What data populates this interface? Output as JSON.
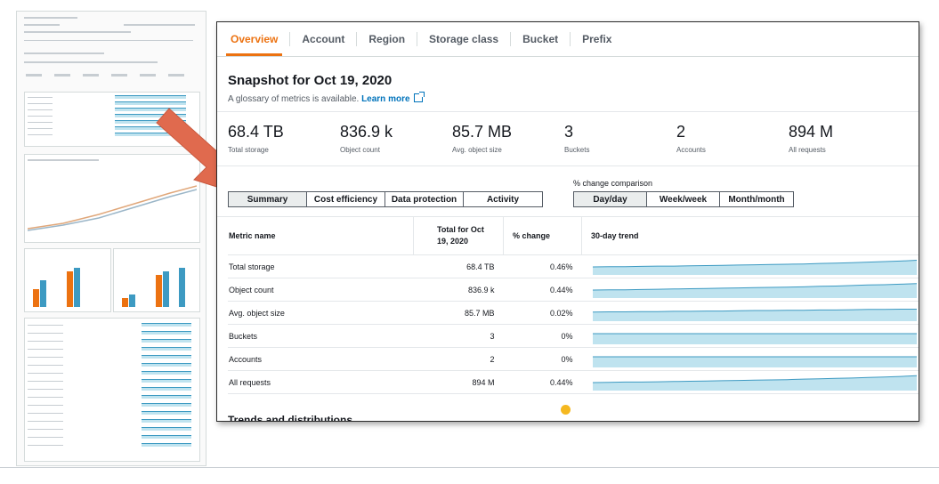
{
  "tabs": [
    {
      "label": "Overview",
      "active": true
    },
    {
      "label": "Account",
      "active": false
    },
    {
      "label": "Region",
      "active": false
    },
    {
      "label": "Storage class",
      "active": false
    },
    {
      "label": "Bucket",
      "active": false
    },
    {
      "label": "Prefix",
      "active": false
    }
  ],
  "snapshot": {
    "title": "Snapshot for Oct 19, 2020",
    "glossary_text": "A glossary of metrics is available.",
    "learn_more": "Learn more"
  },
  "metrics": [
    {
      "value": "68.4 TB",
      "label": "Total storage"
    },
    {
      "value": "836.9 k",
      "label": "Object count"
    },
    {
      "value": "85.7 MB",
      "label": "Avg. object size"
    },
    {
      "value": "3",
      "label": "Buckets"
    },
    {
      "value": "2",
      "label": "Accounts"
    },
    {
      "value": "894 M",
      "label": "All requests"
    }
  ],
  "view_tabs": [
    "Summary",
    "Cost efficiency",
    "Data protection",
    "Activity"
  ],
  "view_selected": "Summary",
  "comparison": {
    "label": "% change comparison",
    "options": [
      "Day/day",
      "Week/week",
      "Month/month"
    ],
    "selected": "Day/day"
  },
  "table": {
    "headers": {
      "metric": "Metric name",
      "total": "Total for Oct 19, 2020",
      "change": "% change",
      "trend": "30-day trend"
    },
    "rows": [
      {
        "name": "Total storage",
        "total": "68.4 TB",
        "change": "0.46%",
        "trend": [
          30,
          31,
          31,
          32,
          33,
          33,
          34,
          35,
          36,
          37,
          38,
          39,
          40,
          41,
          43,
          44,
          46,
          48,
          50,
          52,
          55
        ]
      },
      {
        "name": "Object count",
        "total": "836.9 k",
        "change": "0.44%",
        "trend": [
          30,
          31,
          31,
          32,
          33,
          34,
          35,
          36,
          37,
          38,
          39,
          40,
          41,
          42,
          44,
          45,
          47,
          49,
          50,
          52,
          54
        ]
      },
      {
        "name": "Avg. object size",
        "total": "85.7 MB",
        "change": "0.02%",
        "trend": [
          34,
          35,
          35,
          36,
          36,
          37,
          37,
          38,
          38,
          39,
          40,
          40,
          41,
          41,
          42,
          42,
          43,
          44,
          44,
          45,
          45
        ]
      },
      {
        "name": "Buckets",
        "total": "3",
        "change": "0%",
        "trend": [
          40,
          40,
          40,
          40,
          40,
          40,
          40,
          40,
          40,
          40,
          40,
          40,
          40,
          40,
          40,
          40,
          40,
          40,
          40,
          40,
          40
        ]
      },
      {
        "name": "Accounts",
        "total": "2",
        "change": "0%",
        "trend": [
          40,
          40,
          40,
          40,
          40,
          40,
          40,
          40,
          40,
          40,
          40,
          40,
          40,
          40,
          40,
          40,
          40,
          40,
          40,
          40,
          40
        ]
      },
      {
        "name": "All requests",
        "total": "894 M",
        "change": "0.44%",
        "trend": [
          30,
          31,
          32,
          32,
          33,
          34,
          35,
          36,
          37,
          38,
          39,
          40,
          41,
          43,
          44,
          46,
          47,
          49,
          51,
          53,
          56
        ]
      }
    ]
  },
  "trends_heading": "Trends and distributions",
  "colors": {
    "accent": "#ec7211",
    "link": "#0073bb",
    "spark_fill": "#bfe3ef",
    "spark_line": "#3d9ac2",
    "arrow": "#e06a4e"
  }
}
